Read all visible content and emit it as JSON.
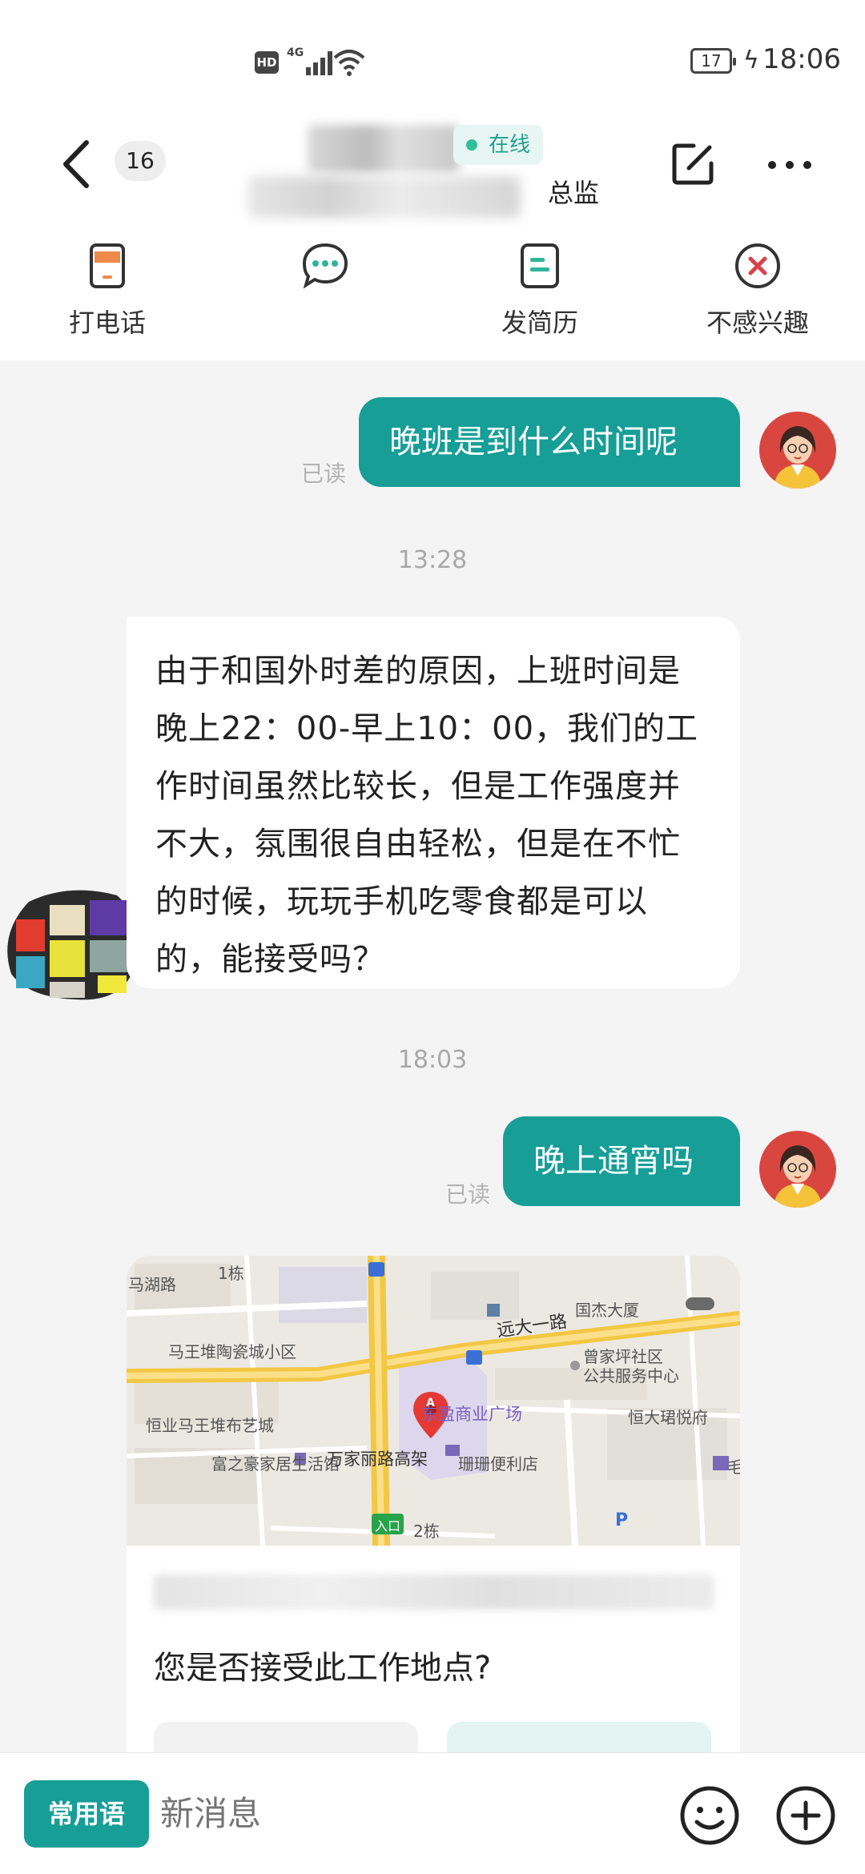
{
  "status_bar": {
    "hd": "HD",
    "network": "4G",
    "battery": "17",
    "time": "18:06"
  },
  "header": {
    "unread_count": "16",
    "online_label": "在线",
    "title_role": "总监"
  },
  "actions": [
    {
      "label": "打电话",
      "icon": "phone-icon"
    },
    {
      "label": "",
      "icon": "chat-icon"
    },
    {
      "label": "发简历",
      "icon": "resume-icon"
    },
    {
      "label": "不感兴趣",
      "icon": "not-interested-icon"
    }
  ],
  "messages": {
    "m1": {
      "text": "晚班是到什么时间呢",
      "status": "已读"
    },
    "time1": "13:28",
    "m2": {
      "text": "由于和国外时差的原因，上班时间是晚上22：00-早上10：00，我们的工作时间虽然比较长，但是工作强度并不大，氛围很自由轻松，但是在不忙的时候，玩玩手机吃零食都是可以的，能接受吗？"
    },
    "time2": "18:03",
    "m3": {
      "text": "晚上通宵吗",
      "status": "已读"
    }
  },
  "map_card": {
    "labels": {
      "mahulu": "马湖路",
      "dong1": "1栋",
      "mawangdui": "马王堆陶瓷城小区",
      "hengye": "恒业马王堆布艺城",
      "fuzhihao": "富之豪家居生活馆",
      "wanjiali": "万家丽路高架",
      "yuanda": "远大一路",
      "guojie": "国杰大厦",
      "zengjiaping": "曾家坪社区",
      "gonggong": "公共服务中心",
      "dongying": "东盈商业广场",
      "hengda": "恒大珺悦府",
      "shanshan": "珊珊便利店",
      "entrance": "入口",
      "dong2": "2栋",
      "parking": "P",
      "marker": "A",
      "mao": "毛"
    },
    "question": "您是否接受此工作地点?"
  },
  "input_bar": {
    "phrases_label": "常用语",
    "placeholder": "新消息"
  },
  "colors": {
    "accent": "#169e97",
    "online_bg": "#e8f6f3",
    "online_text": "#21a08e",
    "decline_red": "#d9424b"
  }
}
